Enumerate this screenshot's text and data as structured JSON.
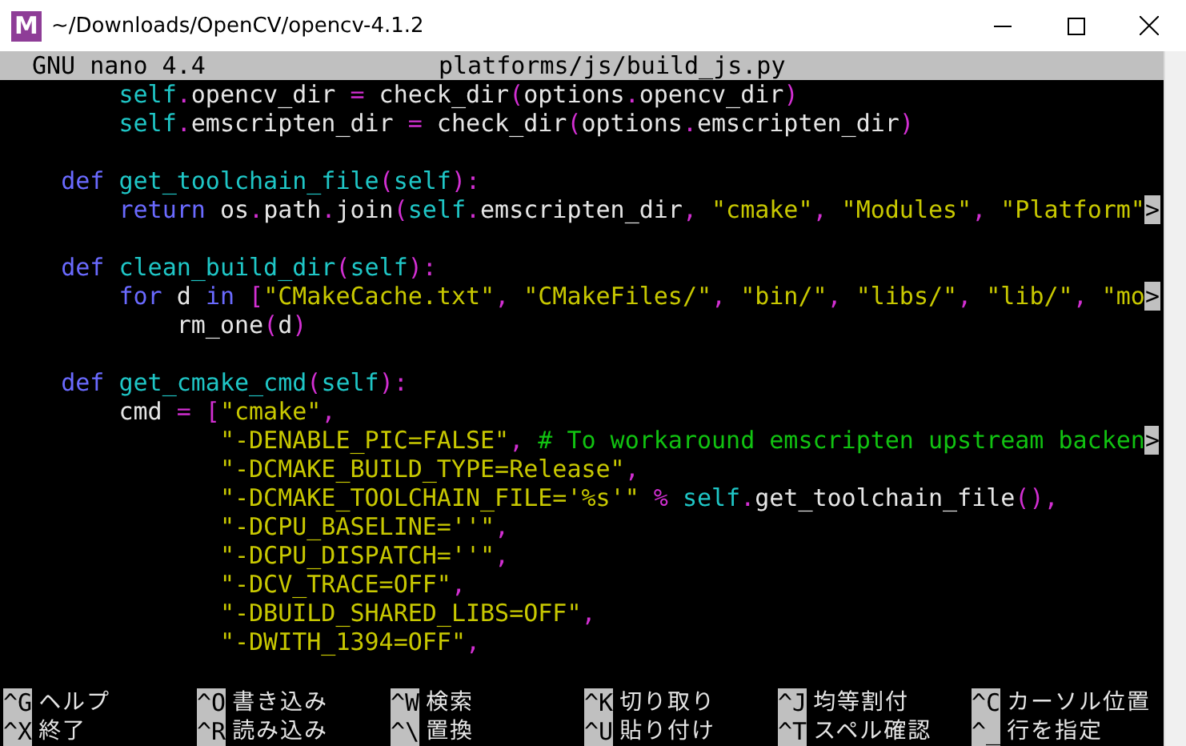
{
  "window": {
    "title": "~/Downloads/OpenCV/opencv-4.1.2",
    "icon_letter": "M"
  },
  "editor": {
    "app": "GNU nano 4.4",
    "filename": "platforms/js/build_js.py"
  },
  "code_lines": [
    {
      "kind": "code",
      "segments": [
        {
          "kind": "self",
          "text": "        self"
        },
        {
          "kind": "op",
          "text": "."
        },
        {
          "kind": "plain",
          "text": "opencv_dir "
        },
        {
          "kind": "op",
          "text": "="
        },
        {
          "kind": "plain",
          "text": " check_dir"
        },
        {
          "kind": "op",
          "text": "("
        },
        {
          "kind": "plain",
          "text": "options"
        },
        {
          "kind": "op",
          "text": "."
        },
        {
          "kind": "plain",
          "text": "opencv_dir"
        },
        {
          "kind": "op",
          "text": ")"
        }
      ]
    },
    {
      "kind": "code",
      "segments": [
        {
          "kind": "self",
          "text": "        self"
        },
        {
          "kind": "op",
          "text": "."
        },
        {
          "kind": "plain",
          "text": "emscripten_dir "
        },
        {
          "kind": "op",
          "text": "="
        },
        {
          "kind": "plain",
          "text": " check_dir"
        },
        {
          "kind": "op",
          "text": "("
        },
        {
          "kind": "plain",
          "text": "options"
        },
        {
          "kind": "op",
          "text": "."
        },
        {
          "kind": "plain",
          "text": "emscripten_dir"
        },
        {
          "kind": "op",
          "text": ")"
        }
      ]
    },
    {
      "kind": "blank"
    },
    {
      "kind": "code",
      "segments": [
        {
          "kind": "keyword",
          "text": "    def"
        },
        {
          "kind": "func",
          "text": " get_toolchain_file"
        },
        {
          "kind": "op",
          "text": "("
        },
        {
          "kind": "self",
          "text": "self"
        },
        {
          "kind": "op",
          "text": "):"
        }
      ]
    },
    {
      "kind": "code",
      "segments": [
        {
          "kind": "keyword",
          "text": "        return"
        },
        {
          "kind": "plain",
          "text": " os"
        },
        {
          "kind": "op",
          "text": "."
        },
        {
          "kind": "plain",
          "text": "path"
        },
        {
          "kind": "op",
          "text": "."
        },
        {
          "kind": "plain",
          "text": "join"
        },
        {
          "kind": "op",
          "text": "("
        },
        {
          "kind": "self",
          "text": "self"
        },
        {
          "kind": "op",
          "text": "."
        },
        {
          "kind": "plain",
          "text": "emscripten_dir"
        },
        {
          "kind": "op",
          "text": ","
        },
        {
          "kind": "string",
          "text": " \"cmake\""
        },
        {
          "kind": "op",
          "text": ","
        },
        {
          "kind": "string",
          "text": " \"Modules\""
        },
        {
          "kind": "op",
          "text": ","
        },
        {
          "kind": "string",
          "text": " \"Platform\""
        }
      ],
      "overflow": ">"
    },
    {
      "kind": "blank"
    },
    {
      "kind": "code",
      "segments": [
        {
          "kind": "keyword",
          "text": "    def"
        },
        {
          "kind": "func",
          "text": " clean_build_dir"
        },
        {
          "kind": "op",
          "text": "("
        },
        {
          "kind": "self",
          "text": "self"
        },
        {
          "kind": "op",
          "text": "):"
        }
      ]
    },
    {
      "kind": "code",
      "segments": [
        {
          "kind": "keyword",
          "text": "        for"
        },
        {
          "kind": "plain",
          "text": " d "
        },
        {
          "kind": "keyword",
          "text": "in"
        },
        {
          "kind": "op",
          "text": " ["
        },
        {
          "kind": "string",
          "text": "\"CMakeCache.txt\""
        },
        {
          "kind": "op",
          "text": ","
        },
        {
          "kind": "string",
          "text": " \"CMakeFiles/\""
        },
        {
          "kind": "op",
          "text": ","
        },
        {
          "kind": "string",
          "text": " \"bin/\""
        },
        {
          "kind": "op",
          "text": ","
        },
        {
          "kind": "string",
          "text": " \"libs/\""
        },
        {
          "kind": "op",
          "text": ","
        },
        {
          "kind": "string",
          "text": " \"lib/\""
        },
        {
          "kind": "op",
          "text": ","
        },
        {
          "kind": "string",
          "text": " \"mo"
        }
      ],
      "overflow": ">"
    },
    {
      "kind": "code",
      "segments": [
        {
          "kind": "plain",
          "text": "            rm_one"
        },
        {
          "kind": "op",
          "text": "("
        },
        {
          "kind": "plain",
          "text": "d"
        },
        {
          "kind": "op",
          "text": ")"
        }
      ]
    },
    {
      "kind": "blank"
    },
    {
      "kind": "code",
      "segments": [
        {
          "kind": "keyword",
          "text": "    def"
        },
        {
          "kind": "func",
          "text": " get_cmake_cmd"
        },
        {
          "kind": "op",
          "text": "("
        },
        {
          "kind": "self",
          "text": "self"
        },
        {
          "kind": "op",
          "text": "):"
        }
      ]
    },
    {
      "kind": "code",
      "segments": [
        {
          "kind": "plain",
          "text": "        cmd "
        },
        {
          "kind": "op",
          "text": "= ["
        },
        {
          "kind": "string",
          "text": "\"cmake\""
        },
        {
          "kind": "op",
          "text": ","
        }
      ]
    },
    {
      "kind": "code",
      "segments": [
        {
          "kind": "string",
          "text": "               \"-DENABLE_PIC=FALSE\""
        },
        {
          "kind": "op",
          "text": ","
        },
        {
          "kind": "comment",
          "text": " # To workaround emscripten upstream backen"
        }
      ],
      "overflow": ">"
    },
    {
      "kind": "code",
      "segments": [
        {
          "kind": "string",
          "text": "               \"-DCMAKE_BUILD_TYPE=Release\""
        },
        {
          "kind": "op",
          "text": ","
        }
      ]
    },
    {
      "kind": "code",
      "segments": [
        {
          "kind": "string",
          "text": "               \"-DCMAKE_TOOLCHAIN_FILE='%s'\""
        },
        {
          "kind": "op",
          "text": " %"
        },
        {
          "kind": "self",
          "text": " self"
        },
        {
          "kind": "op",
          "text": "."
        },
        {
          "kind": "plain",
          "text": "get_toolchain_file"
        },
        {
          "kind": "op",
          "text": "(),"
        }
      ]
    },
    {
      "kind": "code",
      "segments": [
        {
          "kind": "string",
          "text": "               \"-DCPU_BASELINE=''\""
        },
        {
          "kind": "op",
          "text": ","
        }
      ]
    },
    {
      "kind": "code",
      "segments": [
        {
          "kind": "string",
          "text": "               \"-DCPU_DISPATCH=''\""
        },
        {
          "kind": "op",
          "text": ","
        }
      ]
    },
    {
      "kind": "code",
      "segments": [
        {
          "kind": "string",
          "text": "               \"-DCV_TRACE=OFF\""
        },
        {
          "kind": "op",
          "text": ","
        }
      ]
    },
    {
      "kind": "code",
      "segments": [
        {
          "kind": "string",
          "text": "               \"-DBUILD_SHARED_LIBS=OFF\""
        },
        {
          "kind": "op",
          "text": ","
        }
      ]
    },
    {
      "kind": "code",
      "segments": [
        {
          "kind": "string",
          "text": "               \"-DWITH_1394=OFF\""
        },
        {
          "kind": "op",
          "text": ","
        }
      ]
    }
  ],
  "shortcut_rows": [
    [
      {
        "key": "^G",
        "label": "ヘルプ"
      },
      {
        "key": "^O",
        "label": "書き込み"
      },
      {
        "key": "^W",
        "label": "検索"
      },
      {
        "key": "^K",
        "label": "切り取り"
      },
      {
        "key": "^J",
        "label": "均等割付"
      },
      {
        "key": "^C",
        "label": "カーソル位置"
      }
    ],
    [
      {
        "key": "^X",
        "label": "終了"
      },
      {
        "key": "^R",
        "label": "読み込み"
      },
      {
        "key": "^\\",
        "label": "置換"
      },
      {
        "key": "^U",
        "label": "貼り付け"
      },
      {
        "key": "^T",
        "label": "スペル確認"
      },
      {
        "key": "^_",
        "label": "行を指定"
      }
    ]
  ]
}
